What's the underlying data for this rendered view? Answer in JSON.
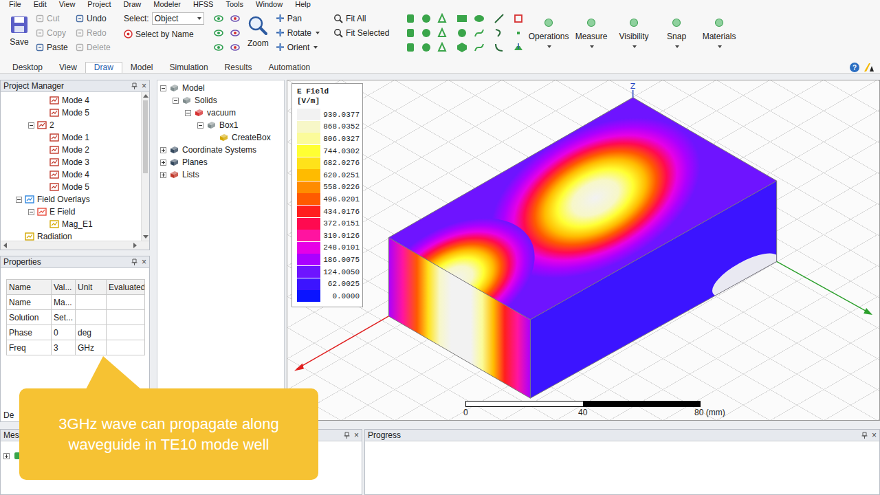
{
  "menu": [
    "File",
    "Edit",
    "View",
    "Project",
    "Draw",
    "Modeler",
    "HFSS",
    "Tools",
    "Window",
    "Help"
  ],
  "ribbon": {
    "save": "Save",
    "edit_actions": [
      {
        "label": "Cut",
        "disabled": true
      },
      {
        "label": "Copy",
        "disabled": true
      },
      {
        "label": "Paste",
        "disabled": false
      },
      {
        "label": "Undo",
        "disabled": false
      },
      {
        "label": "Redo",
        "disabled": true
      },
      {
        "label": "Delete",
        "disabled": true
      }
    ],
    "select_label": "Select:",
    "select_value": "Object",
    "select_by_name": "Select by Name",
    "zoom": "Zoom",
    "view_tools": [
      {
        "label": "Pan",
        "menu": false
      },
      {
        "label": "Rotate",
        "menu": true
      },
      {
        "label": "Orient",
        "menu": true
      }
    ],
    "fit_tools": [
      "Fit All",
      "Fit Selected"
    ],
    "groups": [
      "Operations",
      "Measure",
      "Visibility",
      "Snap",
      "Materials"
    ]
  },
  "tabs": [
    {
      "label": "Desktop",
      "selected": false
    },
    {
      "label": "View",
      "selected": false
    },
    {
      "label": "Draw",
      "selected": true
    },
    {
      "label": "Model",
      "selected": false
    },
    {
      "label": "Simulation",
      "selected": false
    },
    {
      "label": "Results",
      "selected": false
    },
    {
      "label": "Automation",
      "selected": false
    }
  ],
  "help": "?",
  "project_manager": {
    "title": "Project Manager",
    "close": "×",
    "items": [
      {
        "label": "Mode 4",
        "depth": 3,
        "kind": "mode",
        "expandable": false,
        "expanded": false
      },
      {
        "label": "Mode 5",
        "depth": 3,
        "kind": "mode",
        "expandable": false,
        "expanded": false
      },
      {
        "label": "2",
        "depth": 2,
        "kind": "sweep",
        "expandable": true,
        "expanded": true
      },
      {
        "label": "Mode 1",
        "depth": 3,
        "kind": "mode",
        "expandable": false,
        "expanded": false
      },
      {
        "label": "Mode 2",
        "depth": 3,
        "kind": "mode",
        "expandable": false,
        "expanded": false
      },
      {
        "label": "Mode 3",
        "depth": 3,
        "kind": "mode",
        "expandable": false,
        "expanded": false
      },
      {
        "label": "Mode 4",
        "depth": 3,
        "kind": "mode",
        "expandable": false,
        "expanded": false
      },
      {
        "label": "Mode 5",
        "depth": 3,
        "kind": "mode",
        "expandable": false,
        "expanded": false
      },
      {
        "label": "Field Overlays",
        "depth": 1,
        "kind": "overlays",
        "expandable": true,
        "expanded": true
      },
      {
        "label": "E Field",
        "depth": 2,
        "kind": "field",
        "expandable": true,
        "expanded": true
      },
      {
        "label": "Mag_E1",
        "depth": 3,
        "kind": "plot",
        "expandable": false,
        "expanded": false
      },
      {
        "label": "Radiation",
        "depth": 1,
        "kind": "radiation",
        "expandable": false,
        "expanded": false
      }
    ]
  },
  "properties": {
    "title": "Properties",
    "close": "×",
    "columns": [
      "Name",
      "Val...",
      "Unit",
      "Evaluated"
    ],
    "rows": [
      {
        "name": "Name",
        "value": "Ma...",
        "unit": "",
        "evaluated": ""
      },
      {
        "name": "Solution",
        "value": "Set...",
        "unit": "",
        "evaluated": ""
      },
      {
        "name": "Phase",
        "value": "0",
        "unit": "deg",
        "evaluated": ""
      },
      {
        "name": "Freq",
        "value": "3",
        "unit": "GHz",
        "evaluated": ""
      }
    ],
    "footer_tab": "De"
  },
  "model_tree": [
    {
      "label": "Model",
      "depth": 0,
      "kind": "model",
      "expandable": true,
      "expanded": true
    },
    {
      "label": "Solids",
      "depth": 1,
      "kind": "solids",
      "expandable": true,
      "expanded": true
    },
    {
      "label": "vacuum",
      "depth": 2,
      "kind": "material",
      "expandable": true,
      "expanded": true
    },
    {
      "label": "Box1",
      "depth": 3,
      "kind": "box",
      "expandable": true,
      "expanded": true
    },
    {
      "label": "CreateBox",
      "depth": 4,
      "kind": "operation",
      "expandable": false,
      "expanded": false
    },
    {
      "label": "Coordinate Systems",
      "depth": 0,
      "kind": "coords",
      "expandable": true,
      "expanded": false
    },
    {
      "label": "Planes",
      "depth": 0,
      "kind": "planes",
      "expandable": true,
      "expanded": false
    },
    {
      "label": "Lists",
      "depth": 0,
      "kind": "lists",
      "expandable": true,
      "expanded": false
    }
  ],
  "legend": {
    "title": "E Field",
    "unit": "[V/m]",
    "entries": [
      {
        "value": "930.0377",
        "color": "#f2f2f2"
      },
      {
        "value": "868.0352",
        "color": "#f7f7c8"
      },
      {
        "value": "806.0327",
        "color": "#fbfb9a"
      },
      {
        "value": "744.0302",
        "color": "#ffff33"
      },
      {
        "value": "682.0276",
        "color": "#ffe21a"
      },
      {
        "value": "620.0251",
        "color": "#ffbb00"
      },
      {
        "value": "558.0226",
        "color": "#ff8c00"
      },
      {
        "value": "496.0201",
        "color": "#ff5a00"
      },
      {
        "value": "434.0176",
        "color": "#ff1e1e"
      },
      {
        "value": "372.0151",
        "color": "#ff0a50"
      },
      {
        "value": "310.0126",
        "color": "#ff14a0"
      },
      {
        "value": "248.0101",
        "color": "#e600e6"
      },
      {
        "value": "186.0075",
        "color": "#aa00ff"
      },
      {
        "value": "124.0050",
        "color": "#6e14ff"
      },
      {
        "value": "62.0025",
        "color": "#3c14ff"
      },
      {
        "value": "0.0000",
        "color": "#0a14ff"
      }
    ]
  },
  "axis_label": "Z",
  "scale": {
    "ticks": [
      "0",
      "40",
      "80 (mm)"
    ]
  },
  "message_panel": {
    "title": "Mes",
    "close": "×",
    "rows": [
      {
        "expanded": false
      }
    ]
  },
  "progress_panel": {
    "title": "Progress",
    "close": "×"
  },
  "callout": {
    "lines": [
      "3GHz wave can propagate along",
      "waveguide in TE10 mode well"
    ]
  }
}
